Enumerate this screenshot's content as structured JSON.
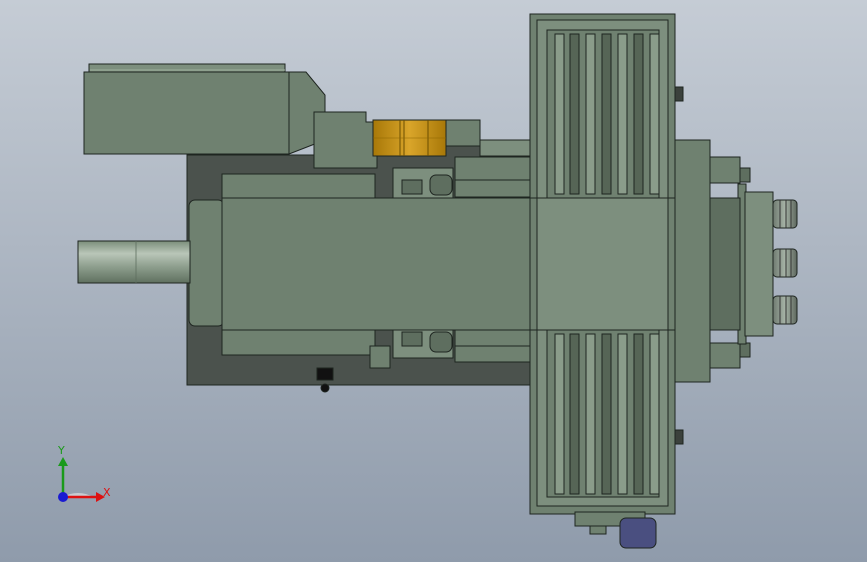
{
  "viewport": {
    "background_top": "#c5ccd5",
    "background_bottom": "#8f9bab"
  },
  "colors": {
    "body_green": "#6f8170",
    "body_green_light": "#7d8f7e",
    "body_dark": "#566556",
    "housing_dark": "#4b524d",
    "shaft_light": "#a9b6a8",
    "bearing_gold": "#b8860b",
    "bearing_gold_light": "#d9a52a",
    "outline": "#1e2520",
    "connector_blue": "#4a4f80"
  },
  "triad": {
    "x_label": "X",
    "y_label": "Y",
    "x_color": "#d11",
    "y_color": "#1a9a1a",
    "z_color": "#1a1ad1"
  }
}
